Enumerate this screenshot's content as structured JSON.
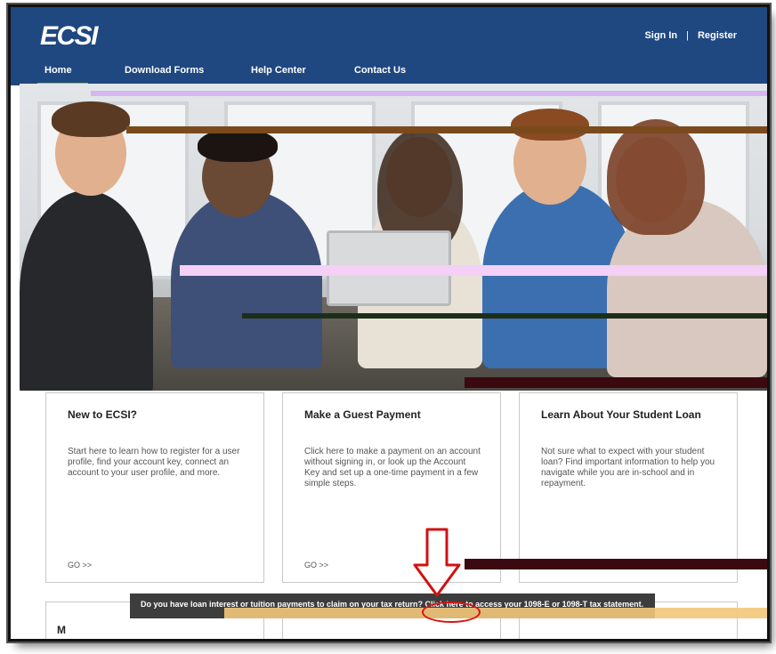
{
  "header": {
    "logo": "ECSI",
    "sign_in": "Sign In",
    "separator": "|",
    "register": "Register"
  },
  "nav": {
    "items": [
      {
        "label": "Home"
      },
      {
        "label": "Download Forms"
      },
      {
        "label": "Help Center"
      },
      {
        "label": "Contact Us"
      }
    ]
  },
  "cards": [
    {
      "title": "New to ECSI?",
      "body": "Start here to learn how to register for a user profile, find your account key, connect an account to your user profile, and more.",
      "go": "GO >>"
    },
    {
      "title": "Make a Guest Payment",
      "body": "Click here to make a payment on an account without signing in, or look up the Account Key and set up a one-time payment in a few simple steps.",
      "go": "GO >>"
    },
    {
      "title": "Learn About Your Student Loan",
      "body": "Not sure what to expect with your student loan? Find important information to help you navigate while you are in-school and in repayment.",
      "go": ""
    }
  ],
  "tooltip": {
    "text": "Do you have loan interest or tuition payments to claim on your tax return? Click here to access your 1098-E or 1098-T tax statement."
  },
  "row2": {
    "first_title": "M"
  },
  "colors": {
    "header_bg": "#1f4780",
    "nav_active": "#8cc63f",
    "annotation": "#d11111"
  }
}
